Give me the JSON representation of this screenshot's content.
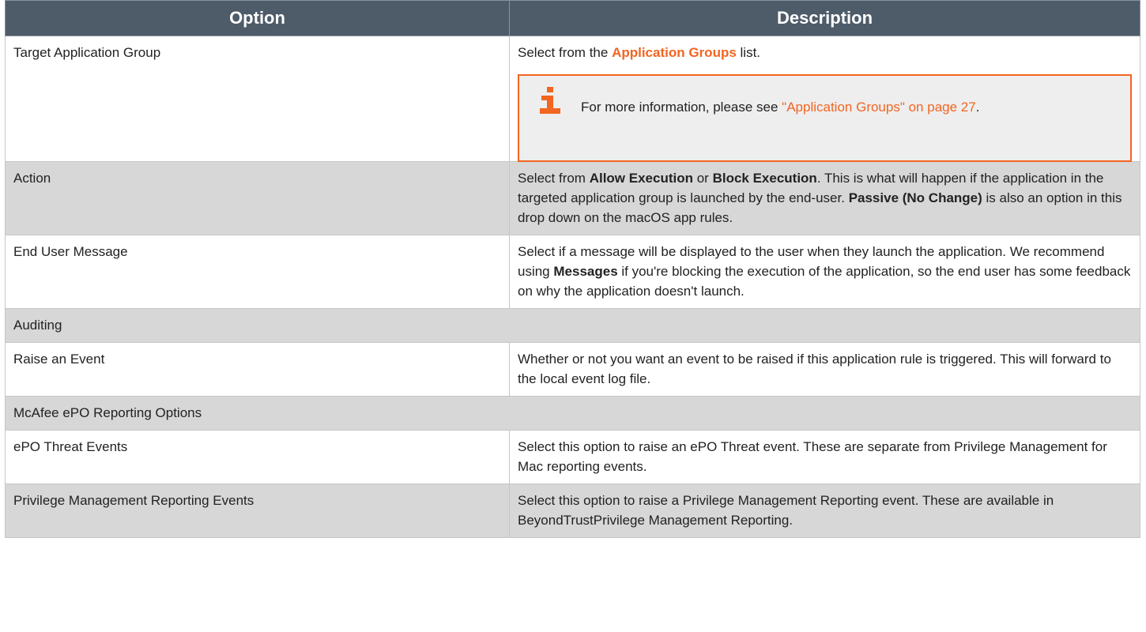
{
  "table": {
    "headers": {
      "option": "Option",
      "description": "Description"
    },
    "rows": {
      "target": {
        "option": "Target Application Group",
        "desc_pre": "Select from the ",
        "desc_link": "Application Groups",
        "desc_post": " list.",
        "note": {
          "text_pre": "For more information, please see ",
          "link_text": "\"Application Groups\" on page 27",
          "text_post": "."
        }
      },
      "action": {
        "option": "Action",
        "p1": "Select from ",
        "b1": "Allow Execution",
        "p2": " or ",
        "b2": "Block Execution",
        "p3": ". This is what will happen if the application in the targeted application group is launched by the end-user. ",
        "b3": "Passive (No Change)",
        "p4": " is also an option in this drop down on the macOS app rules."
      },
      "end_user_message": {
        "option": "End User Message",
        "p1": "Select if a message will be displayed to the user when they launch the application. We recommend using ",
        "b1": "Messages",
        "p2": " if you're blocking the execution of the application, so the end user has some feedback on why the application doesn't launch."
      },
      "auditing": {
        "label": "Auditing"
      },
      "raise_event": {
        "option": "Raise an Event",
        "description": "Whether or not you want an event to be raised if this application rule is triggered. This will forward to the local event log file."
      },
      "mcafee": {
        "label": "McAfee ePO Reporting Options"
      },
      "epo_threat": {
        "option": "ePO Threat Events",
        "description": "Select this option to raise an ePO Threat event. These are separate from Privilege Management for Mac reporting events."
      },
      "pm_reporting": {
        "option": "Privilege Management Reporting Events",
        "description": "Select this option to raise a Privilege Management Reporting event. These are available in BeyondTrustPrivilege Management Reporting."
      }
    }
  },
  "colors": {
    "header_bg": "#4e5b69",
    "accent": "#f26522",
    "shaded_row": "#d7d7d7",
    "note_bg": "#eeeeee"
  },
  "icons": {
    "note": "info-icon"
  }
}
